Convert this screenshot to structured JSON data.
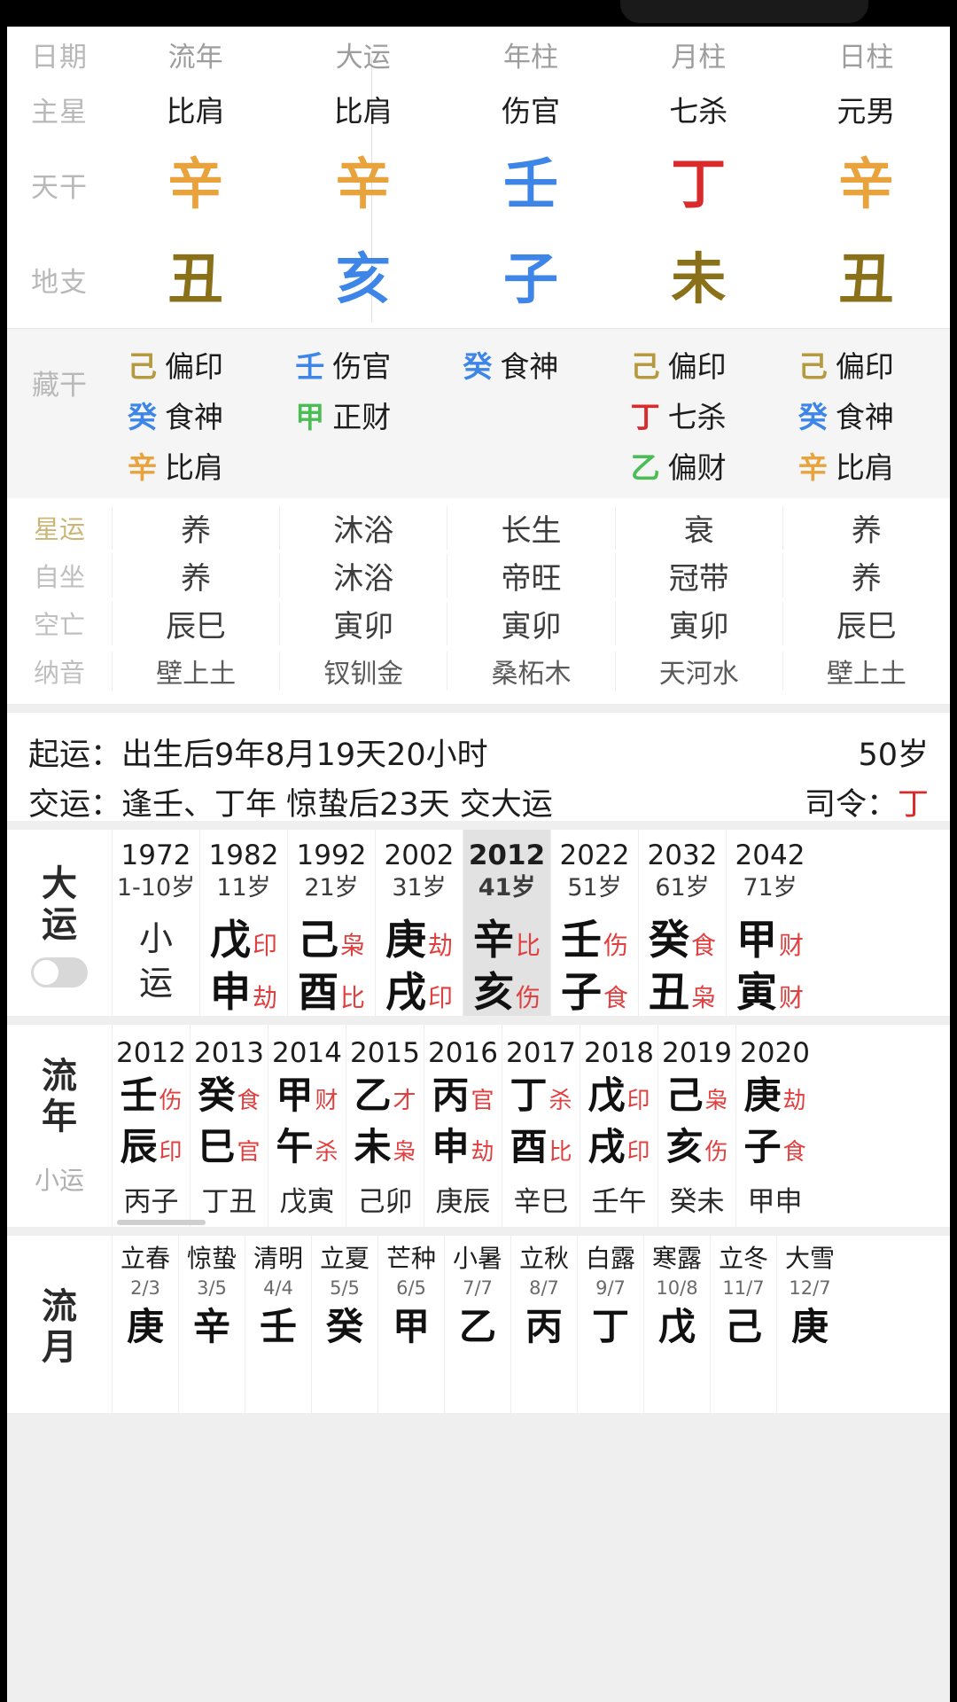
{
  "pillars": {
    "row_labels": [
      "日期",
      "主星",
      "天干",
      "地支"
    ],
    "columns": [
      {
        "header": "流年",
        "main_star": "比肩",
        "stem": "辛",
        "stem_element": "metal",
        "branch": "丑",
        "branch_element": "earth"
      },
      {
        "header": "大运",
        "main_star": "比肩",
        "stem": "辛",
        "stem_element": "metal",
        "branch": "亥",
        "branch_element": "water"
      },
      {
        "header": "年柱",
        "main_star": "伤官",
        "stem": "壬",
        "stem_element": "water",
        "branch": "子",
        "branch_element": "water"
      },
      {
        "header": "月柱",
        "main_star": "七杀",
        "stem": "丁",
        "stem_element": "fire",
        "branch": "未",
        "branch_element": "earth"
      },
      {
        "header": "日柱",
        "main_star": "元男",
        "stem": "辛",
        "stem_element": "metal",
        "branch": "丑",
        "branch_element": "earth"
      }
    ]
  },
  "hidden_stems": {
    "label": "藏干",
    "columns": [
      [
        {
          "stem": "己",
          "element": "earth",
          "god": "偏印"
        },
        {
          "stem": "癸",
          "element": "water",
          "god": "食神"
        },
        {
          "stem": "辛",
          "element": "metal",
          "god": "比肩"
        }
      ],
      [
        {
          "stem": "壬",
          "element": "water",
          "god": "伤官"
        },
        {
          "stem": "甲",
          "element": "wood",
          "god": "正财"
        }
      ],
      [
        {
          "stem": "癸",
          "element": "water",
          "god": "食神"
        }
      ],
      [
        {
          "stem": "己",
          "element": "earth",
          "god": "偏印"
        },
        {
          "stem": "丁",
          "element": "fire",
          "god": "七杀"
        },
        {
          "stem": "乙",
          "element": "wood",
          "god": "偏财"
        }
      ],
      [
        {
          "stem": "己",
          "element": "earth",
          "god": "偏印"
        },
        {
          "stem": "癸",
          "element": "water",
          "god": "食神"
        },
        {
          "stem": "辛",
          "element": "metal",
          "god": "比肩"
        }
      ]
    ]
  },
  "fortune_rows": [
    {
      "label": "星运",
      "values": [
        "养",
        "沐浴",
        "长生",
        "衰",
        "养"
      ]
    },
    {
      "label": "自坐",
      "values": [
        "养",
        "沐浴",
        "帝旺",
        "冠带",
        "养"
      ]
    },
    {
      "label": "空亡",
      "values": [
        "辰巳",
        "寅卯",
        "寅卯",
        "寅卯",
        "辰巳"
      ]
    },
    {
      "label": "纳音",
      "values": [
        "壁上土",
        "钗钏金",
        "桑柘木",
        "天河水",
        "壁上土"
      ]
    }
  ],
  "qiyun": {
    "line1_label": "起运：",
    "line1_text": "出生后9年8月19天20小时",
    "line1_right": "50岁",
    "line2_label": "交运：",
    "line2_text": "逢壬、丁年 惊蛰后23天 交大运",
    "line2_right_label": "司令：",
    "line2_right_value": "丁"
  },
  "dayun": {
    "title_line1": "大",
    "title_line2": "运",
    "toggle_on": false,
    "cells": [
      {
        "year": "1972",
        "age": "1-10岁",
        "plain": [
          "小",
          "运"
        ],
        "active": false
      },
      {
        "year": "1982",
        "age": "11岁",
        "stem": "戊",
        "stem_god": "印",
        "branch": "申",
        "branch_god": "劫",
        "active": false
      },
      {
        "year": "1992",
        "age": "21岁",
        "stem": "己",
        "stem_god": "枭",
        "branch": "酉",
        "branch_god": "比",
        "active": false
      },
      {
        "year": "2002",
        "age": "31岁",
        "stem": "庚",
        "stem_god": "劫",
        "branch": "戌",
        "branch_god": "印",
        "active": false
      },
      {
        "year": "2012",
        "age": "41岁",
        "stem": "辛",
        "stem_god": "比",
        "branch": "亥",
        "branch_god": "伤",
        "active": true
      },
      {
        "year": "2022",
        "age": "51岁",
        "stem": "壬",
        "stem_god": "伤",
        "branch": "子",
        "branch_god": "食",
        "active": false
      },
      {
        "year": "2032",
        "age": "61岁",
        "stem": "癸",
        "stem_god": "食",
        "branch": "丑",
        "branch_god": "枭",
        "active": false
      },
      {
        "year": "2042",
        "age": "71岁",
        "stem": "甲",
        "stem_god": "财",
        "branch": "寅",
        "branch_god": "财",
        "active": false
      }
    ]
  },
  "liunian": {
    "title_line1": "流",
    "title_line2": "年",
    "subtitle": "小运",
    "cells": [
      {
        "year": "2012",
        "stem": "壬",
        "stem_god": "伤",
        "branch": "辰",
        "branch_god": "印",
        "xiaoyun": "丙子"
      },
      {
        "year": "2013",
        "stem": "癸",
        "stem_god": "食",
        "branch": "巳",
        "branch_god": "官",
        "xiaoyun": "丁丑"
      },
      {
        "year": "2014",
        "stem": "甲",
        "stem_god": "财",
        "branch": "午",
        "branch_god": "杀",
        "xiaoyun": "戊寅"
      },
      {
        "year": "2015",
        "stem": "乙",
        "stem_god": "才",
        "branch": "未",
        "branch_god": "枭",
        "xiaoyun": "己卯"
      },
      {
        "year": "2016",
        "stem": "丙",
        "stem_god": "官",
        "branch": "申",
        "branch_god": "劫",
        "xiaoyun": "庚辰"
      },
      {
        "year": "2017",
        "stem": "丁",
        "stem_god": "杀",
        "branch": "酉",
        "branch_god": "比",
        "xiaoyun": "辛巳"
      },
      {
        "year": "2018",
        "stem": "戊",
        "stem_god": "印",
        "branch": "戌",
        "branch_god": "印",
        "xiaoyun": "壬午"
      },
      {
        "year": "2019",
        "stem": "己",
        "stem_god": "枭",
        "branch": "亥",
        "branch_god": "伤",
        "xiaoyun": "癸未"
      },
      {
        "year": "2020",
        "stem": "庚",
        "stem_god": "劫",
        "branch": "子",
        "branch_god": "食",
        "xiaoyun": "甲申"
      }
    ]
  },
  "liuyue": {
    "title_line1": "流",
    "title_line2": "月",
    "cells": [
      {
        "term": "立春",
        "date": "2/3",
        "stem": "庚"
      },
      {
        "term": "惊蛰",
        "date": "3/5",
        "stem": "辛"
      },
      {
        "term": "清明",
        "date": "4/4",
        "stem": "壬"
      },
      {
        "term": "立夏",
        "date": "5/5",
        "stem": "癸"
      },
      {
        "term": "芒种",
        "date": "6/5",
        "stem": "甲"
      },
      {
        "term": "小暑",
        "date": "7/7",
        "stem": "乙"
      },
      {
        "term": "立秋",
        "date": "8/7",
        "stem": "丙"
      },
      {
        "term": "白露",
        "date": "9/7",
        "stem": "丁"
      },
      {
        "term": "寒露",
        "date": "10/8",
        "stem": "戊"
      },
      {
        "term": "立冬",
        "date": "11/7",
        "stem": "己"
      },
      {
        "term": "大雪",
        "date": "12/7",
        "stem": "庚"
      }
    ]
  },
  "colors": {
    "metal": "#e8a33d",
    "water": "#3d86e8",
    "fire": "#d92b2b",
    "earth": "#8a7018",
    "wood": "#4bbd55",
    "god_red": "#e04040",
    "active_bg": "#e2e2e2"
  }
}
